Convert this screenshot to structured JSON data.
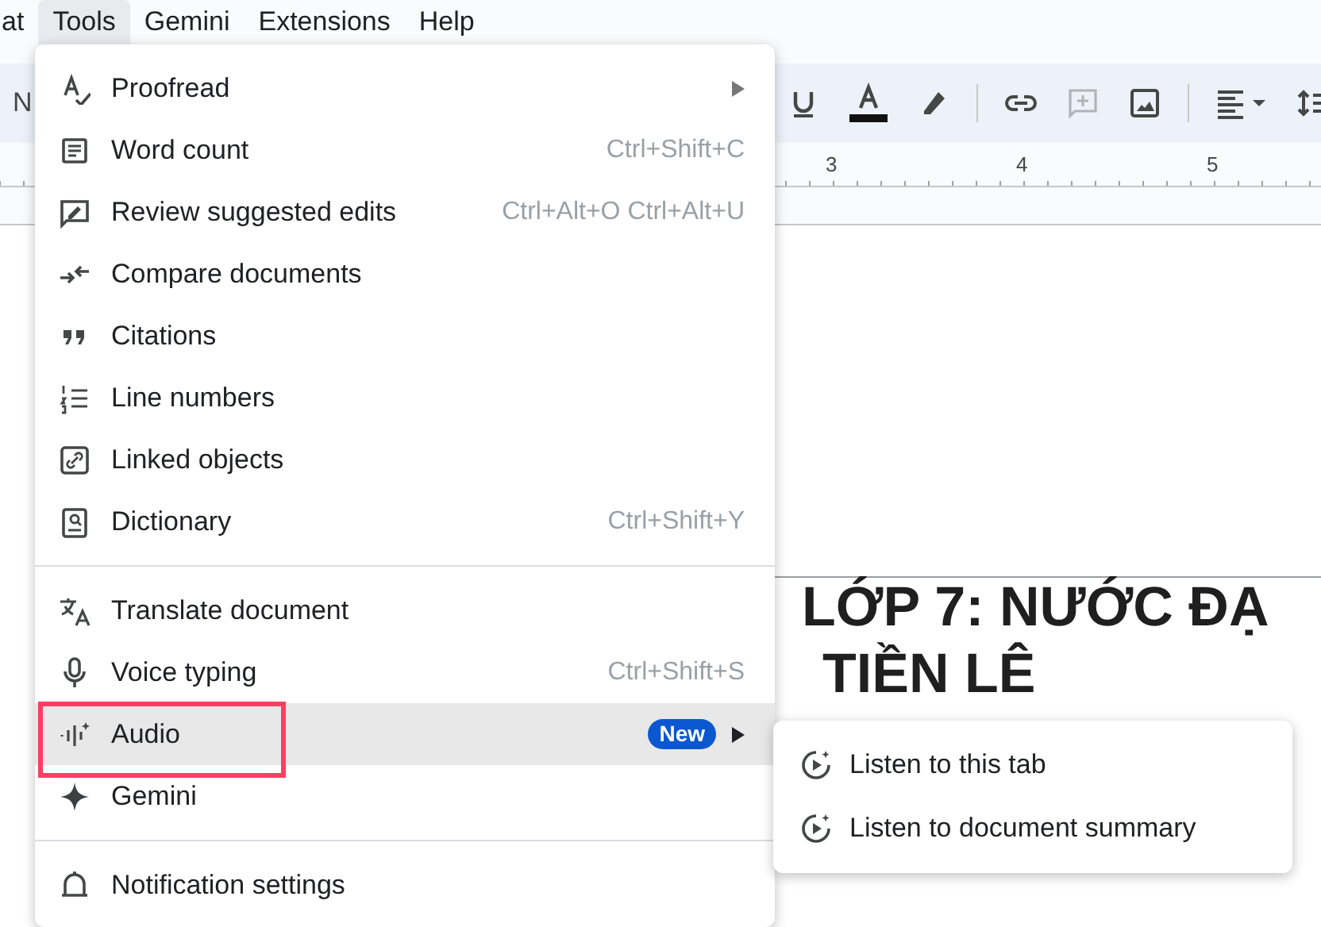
{
  "menubar": [
    {
      "label": "at",
      "selected": false
    },
    {
      "label": "Tools",
      "selected": true
    },
    {
      "label": "Gemini",
      "selected": false
    },
    {
      "label": "Extensions",
      "selected": false
    },
    {
      "label": "Help",
      "selected": false
    }
  ],
  "toolbar": {
    "style_text": "N"
  },
  "ruler": [
    "3",
    "4",
    "5"
  ],
  "document": {
    "heading_lines": [
      "LỚP 7: NƯỚC ĐẠ",
      "TIỀN LÊ"
    ]
  },
  "tools_menu": {
    "sections": [
      [
        {
          "label": "Proofread",
          "has_submenu": true,
          "selected": false,
          "outlined": false
        },
        {
          "label": "Word count",
          "shortcut": "Ctrl+Shift+C",
          "has_submenu": false,
          "selected": false,
          "outlined": false
        },
        {
          "label": "Review suggested edits",
          "shortcut": "Ctrl+Alt+O Ctrl+Alt+U",
          "has_submenu": false,
          "selected": false,
          "outlined": false
        },
        {
          "label": "Compare documents",
          "has_submenu": false,
          "selected": false,
          "outlined": false
        },
        {
          "label": "Citations",
          "has_submenu": false,
          "selected": false,
          "outlined": false
        },
        {
          "label": "Line numbers",
          "has_submenu": false,
          "selected": false,
          "outlined": false
        },
        {
          "label": "Linked objects",
          "has_submenu": false,
          "selected": false,
          "outlined": false
        },
        {
          "label": "Dictionary",
          "shortcut": "Ctrl+Shift+Y",
          "has_submenu": false,
          "selected": false,
          "outlined": false
        }
      ],
      [
        {
          "label": "Translate document",
          "has_submenu": false,
          "selected": false,
          "outlined": false
        },
        {
          "label": "Voice typing",
          "shortcut": "Ctrl+Shift+S",
          "has_submenu": false,
          "selected": false,
          "outlined": false
        },
        {
          "label": "Audio",
          "badge": "New",
          "has_submenu": true,
          "selected": true,
          "outlined": true
        },
        {
          "label": "Gemini",
          "has_submenu": false,
          "selected": false,
          "outlined": false
        }
      ],
      [
        {
          "label": "Notification settings",
          "has_submenu": false,
          "selected": false,
          "outlined": false
        }
      ]
    ]
  },
  "audio_submenu": [
    {
      "label": "Listen to this tab"
    },
    {
      "label": "Listen to document summary"
    }
  ]
}
